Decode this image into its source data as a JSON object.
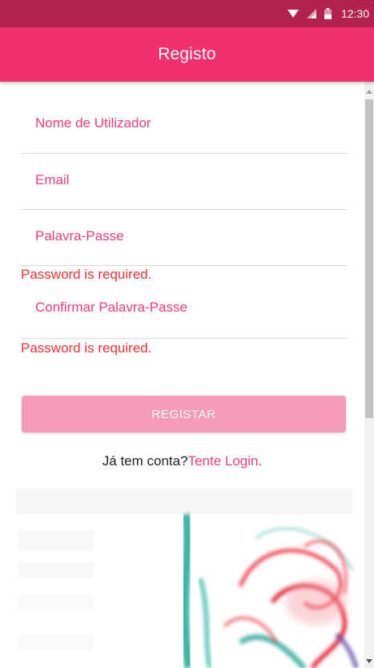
{
  "status_bar": {
    "time": "12:30",
    "icons": [
      "wifi-icon",
      "signal-icon",
      "battery-icon"
    ],
    "background": "#b3214e"
  },
  "app_bar": {
    "title": "Registo",
    "background": "#f2306e"
  },
  "form": {
    "username_label": "Nome de Utilizador",
    "email_label": "Email",
    "password_label": "Palavra-Passe",
    "password_error": "Password is required.",
    "confirm_password_label": "Confirmar Palavra-Passe",
    "confirm_password_error": "Password is required.",
    "label_color": "#ee3f78",
    "error_color": "#ef3236"
  },
  "register_button": {
    "label": "REGISTAR",
    "background": "#f69bbb",
    "enabled": false
  },
  "login_prompt": {
    "text": "Já tem conta?",
    "link": "Tente Login."
  },
  "background_image": {
    "description_icon": "smoke-art-icon"
  }
}
